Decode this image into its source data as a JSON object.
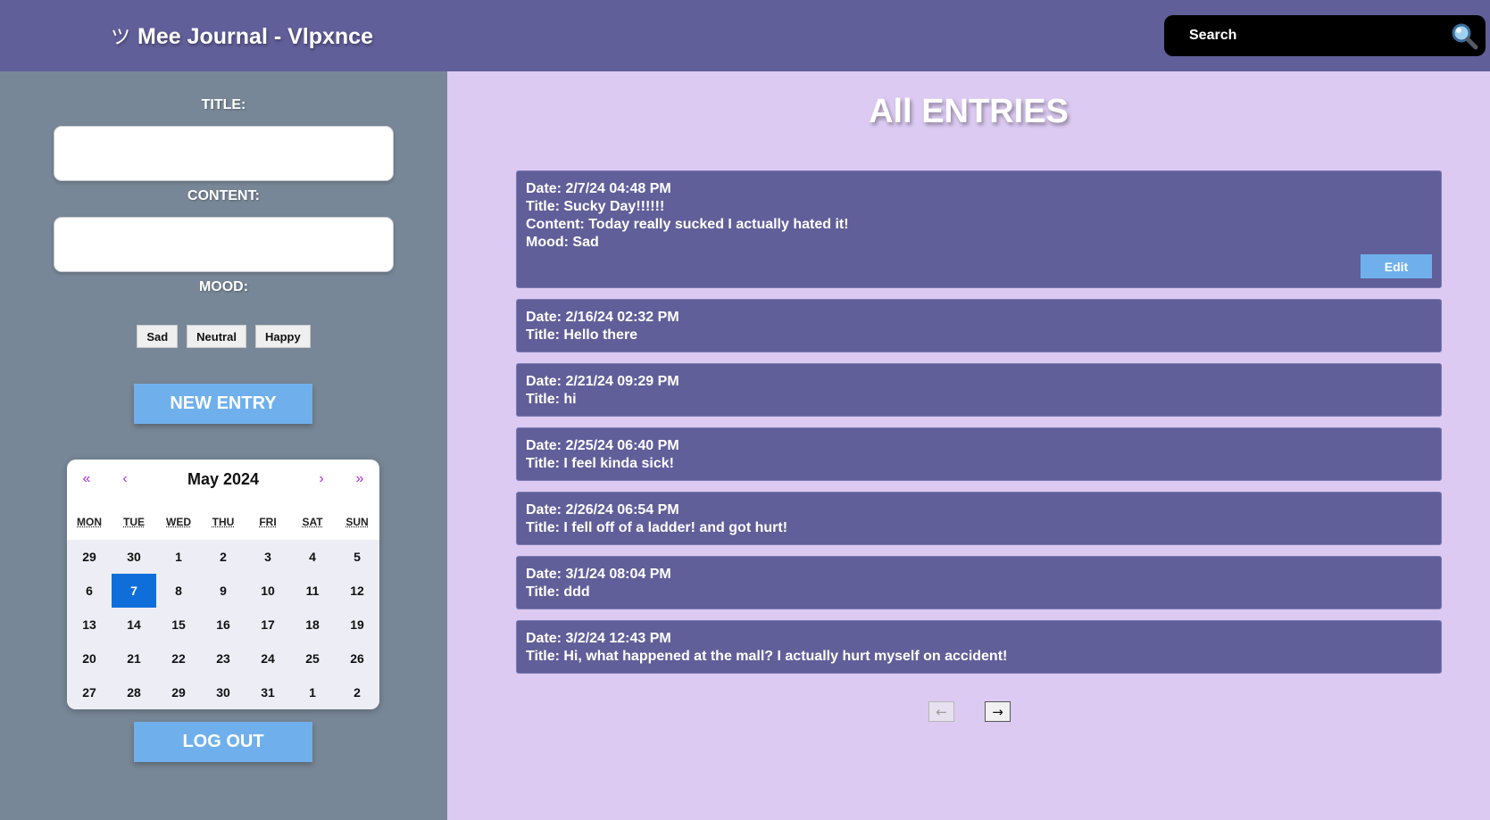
{
  "header": {
    "logo_glyph": "ツ",
    "title": "Mee Journal - Vlpxnce",
    "search_placeholder": "Search",
    "search_icon": "magnifier-icon"
  },
  "sidebar": {
    "title_label": "TITLE:",
    "title_value": "",
    "content_label": "CONTENT:",
    "content_value": "",
    "mood_label": "MOOD:",
    "moods": [
      "Sad",
      "Neutral",
      "Happy"
    ],
    "new_entry_label": "NEW ENTRY",
    "logout_label": "LOG OUT"
  },
  "calendar": {
    "first_label": "«",
    "prev_label": "‹",
    "month_label": "May 2024",
    "next_label": "›",
    "last_label": "»",
    "weekdays": [
      "MON",
      "TUE",
      "WED",
      "THU",
      "FRI",
      "SAT",
      "SUN"
    ],
    "days": [
      "29",
      "30",
      "1",
      "2",
      "3",
      "4",
      "5",
      "6",
      "7",
      "8",
      "9",
      "10",
      "11",
      "12",
      "13",
      "14",
      "15",
      "16",
      "17",
      "18",
      "19",
      "20",
      "21",
      "22",
      "23",
      "24",
      "25",
      "26",
      "27",
      "28",
      "29",
      "30",
      "31",
      "1",
      "2"
    ],
    "selected_day": "7",
    "selected_color": "#0f6ed9",
    "nav_color": "#b02ee6"
  },
  "main": {
    "heading": "All ENTRIES",
    "entries": [
      {
        "date": "Date: 2/7/24 04:48 PM",
        "title": "Title: Sucky Day!!!!!!",
        "content": "Content: Today really sucked I actually hated it!",
        "mood": "Mood: Sad",
        "edit_label": "Edit"
      },
      {
        "date": "Date: 2/16/24 02:32 PM",
        "title": "Title: Hello there"
      },
      {
        "date": "Date: 2/21/24 09:29 PM",
        "title": "Title: hi"
      },
      {
        "date": "Date: 2/25/24 06:40 PM",
        "title": "Title: I feel kinda sick!"
      },
      {
        "date": "Date: 2/26/24 06:54 PM",
        "title": "Title: I fell off of a ladder! and got hurt!"
      },
      {
        "date": "Date: 3/1/24 08:04 PM",
        "title": "Title: ddd"
      },
      {
        "date": "Date: 3/2/24 12:43 PM",
        "title": "Title: Hi, what happened at the mall? I actually hurt myself on accident!"
      }
    ],
    "pager": {
      "prev_label": "←",
      "next_label": "→"
    }
  },
  "colors": {
    "header_bg": "#615f99",
    "sidebar_bg": "#788797",
    "main_bg": "#dccaf2",
    "accent_button": "#6fb0ec",
    "entry_bg": "#615f99"
  }
}
